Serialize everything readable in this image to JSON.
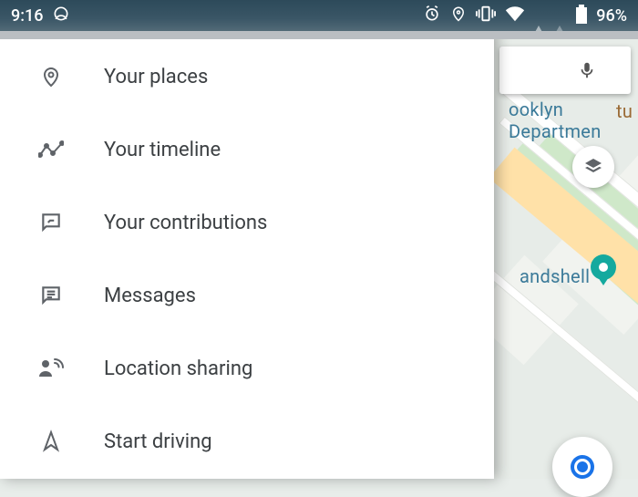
{
  "status": {
    "time": "9:16",
    "battery": "96%",
    "peek_text": "Brooklyn"
  },
  "map": {
    "label_ooklyn": "ooklyn Departmen",
    "label_andshell": "andshell",
    "label_tu": "tu"
  },
  "drawer": {
    "items": [
      {
        "key": "your-places",
        "label": "Your places"
      },
      {
        "key": "your-timeline",
        "label": "Your timeline"
      },
      {
        "key": "contributions",
        "label": "Your contributions"
      },
      {
        "key": "messages",
        "label": "Messages"
      },
      {
        "key": "location-share",
        "label": "Location sharing"
      },
      {
        "key": "start-driving",
        "label": "Start driving"
      }
    ]
  }
}
